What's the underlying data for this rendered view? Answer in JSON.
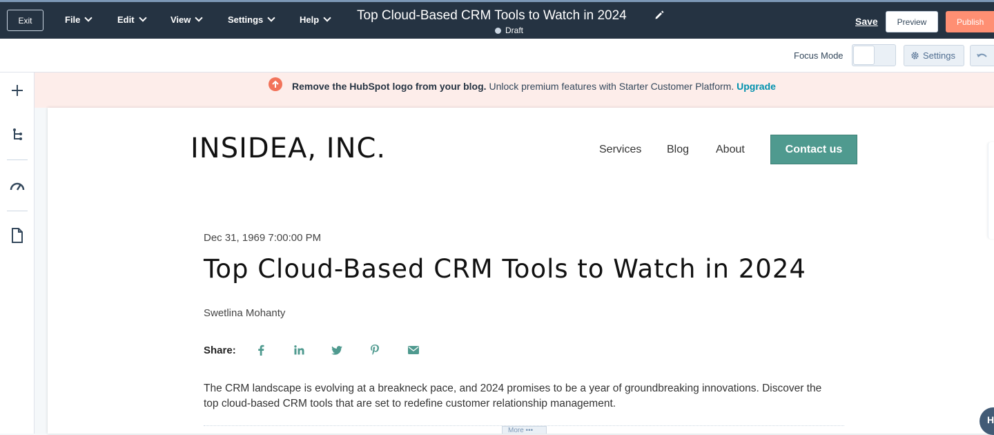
{
  "topbar": {
    "exit_label": "Exit",
    "menus": [
      "File",
      "Edit",
      "View",
      "Settings",
      "Help"
    ],
    "title": "Top Cloud-Based CRM Tools to Watch in 2024",
    "status": "Draft",
    "save_label": "Save",
    "preview_label": "Preview",
    "publish_label": "Publish"
  },
  "toolbar2": {
    "focus_mode_label": "Focus Mode",
    "focus_mode_on": false,
    "settings_label": "Settings"
  },
  "banner": {
    "bold_text": "Remove the HubSpot logo from your blog.",
    "text": "Unlock premium features with Starter Customer Platform.",
    "link_text": "Upgrade"
  },
  "site": {
    "logo_text": "INSIDEA, INC.",
    "nav": [
      "Services",
      "Blog",
      "About"
    ],
    "cta_label": "Contact us"
  },
  "post": {
    "date": "Dec 31, 1969 7:00:00 PM",
    "title": "Top Cloud-Based CRM Tools to Watch in 2024",
    "author": "Swetlina Mohanty",
    "share_label": "Share:",
    "share_icons": [
      "facebook-icon",
      "linkedin-icon",
      "twitter-icon",
      "pinterest-icon",
      "email-icon"
    ],
    "body": "The CRM landscape is evolving at a breakneck pace, and 2024 promises to be a year of groundbreaking innovations. Discover the top cloud-based CRM tools that are set to redefine customer relationship management.",
    "more_label": "More •••"
  },
  "help_bubble_label": "H",
  "colors": {
    "topbar_bg": "#253342",
    "publish": "#ff8f73",
    "accent_teal": "#4f9a8f",
    "banner_bg": "#fdedea",
    "link": "#0091ae"
  }
}
